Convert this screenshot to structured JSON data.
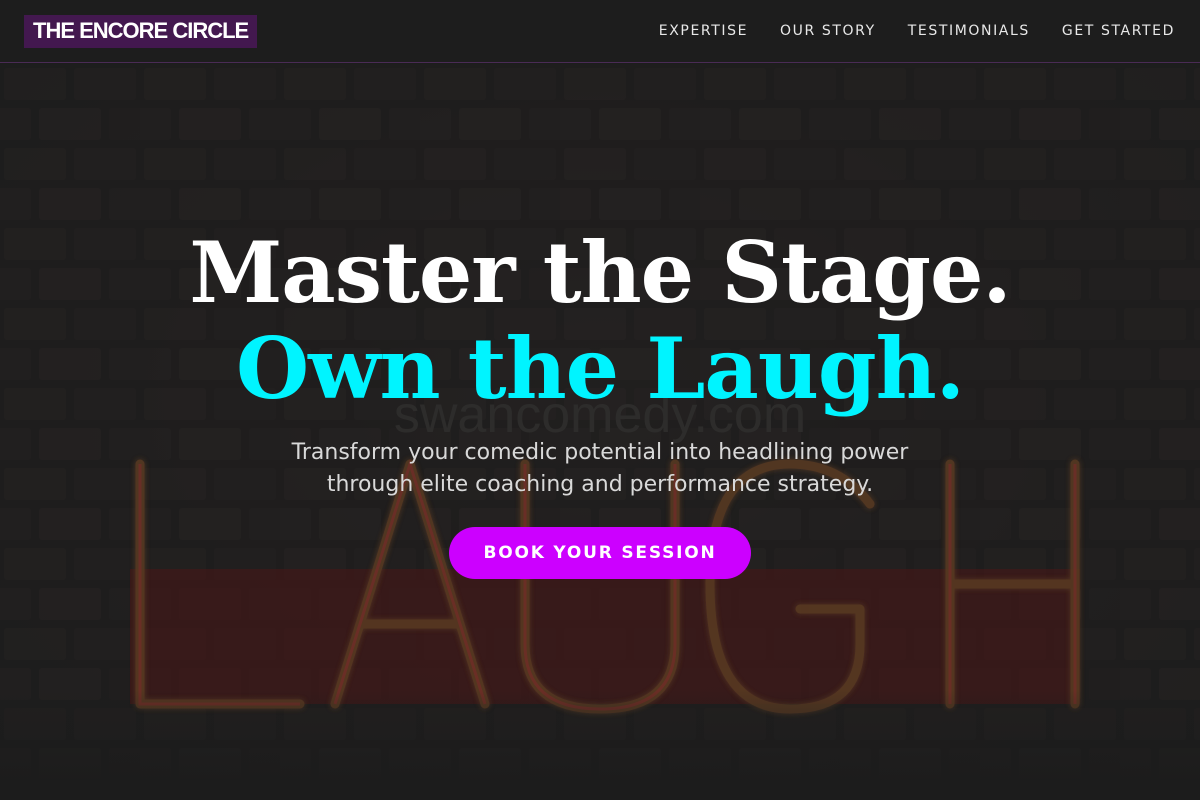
{
  "brand": {
    "name": "THE ENCORE CIRCLE",
    "bg_color": "#43184f"
  },
  "nav": {
    "items": [
      {
        "label": "EXPERTISE"
      },
      {
        "label": "OUR STORY"
      },
      {
        "label": "TESTIMONIALS"
      },
      {
        "label": "GET STARTED"
      }
    ]
  },
  "hero": {
    "headline_line1": "Master the Stage.",
    "headline_line2": "Own the Laugh.",
    "subtitle": "Transform your comedic potential into headlining power through elite coaching and performance strategy.",
    "cta_label": "BOOK YOUR SESSION",
    "accent_color": "#00f4ff",
    "cta_color": "#cc00ff"
  },
  "background": {
    "description_icon": "neon-sign-on-brick-wall",
    "neon_text": "LAUGH",
    "wall_text": "swancomedy.com"
  }
}
